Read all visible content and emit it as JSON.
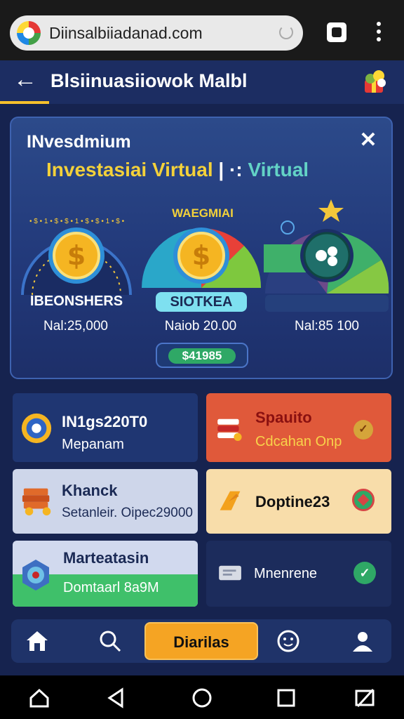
{
  "browser": {
    "url": "Diinsalbiiadanad.com"
  },
  "header": {
    "title": "Blsiinuasiiowok Malbl"
  },
  "panel": {
    "title": "INvesdmium",
    "subtitle_main": "Investasiai Virtual",
    "subtitle_sep": " | ·: ",
    "subtitle_accent": "Virtual",
    "gauges": [
      {
        "label": "IBEONSHERS",
        "value": "Nal:25,000",
        "ring_text": "• $ • 1 • $ • $ • 1 • $ • $ • 1 • $ •"
      },
      {
        "label": "SIOTKEA",
        "value": "Naiob 20.00",
        "top_text": "WAEGMIAI"
      },
      {
        "label": "",
        "value": "Nal:85 100"
      }
    ],
    "badge": "$41985"
  },
  "cards": [
    {
      "title": "IN1gs220T0",
      "subtitle": "Mepanam",
      "bg": "#1f3672",
      "title_color": "#ffffff",
      "sub_color": "#ffffff"
    },
    {
      "title": "Spauito",
      "subtitle": "Cdcahan Onp",
      "bg": "#e0593a",
      "title_color": "#8a1010",
      "sub_color": "#f8d34a"
    },
    {
      "title": "Khanck",
      "subtitle": "Setanleir. Oipec29000",
      "bg": "#ced6ea",
      "title_color": "#1b2a55",
      "sub_color": "#1b2a55"
    },
    {
      "title": "Doptine23",
      "subtitle": "",
      "bg": "#f8ddaa",
      "title_color": "#111111",
      "sub_color": "#111111"
    },
    {
      "title": "Marteatasin",
      "subtitle": "Domtaarl 8a9M",
      "bg": "#d1d9ee",
      "title_color": "#1b2a55",
      "sub_color": "#ffffff"
    },
    {
      "title": "",
      "subtitle": "Mnenrene",
      "bg": "#1c2c5c",
      "title_color": "#ffffff",
      "sub_color": "#ffffff"
    }
  ],
  "nav": {
    "primary_label": "Diarilas"
  },
  "colors": {
    "accent_yellow": "#f3d13a",
    "accent_teal": "#63d3c6",
    "primary_orange": "#f5a423",
    "success_green": "#2fa866"
  }
}
